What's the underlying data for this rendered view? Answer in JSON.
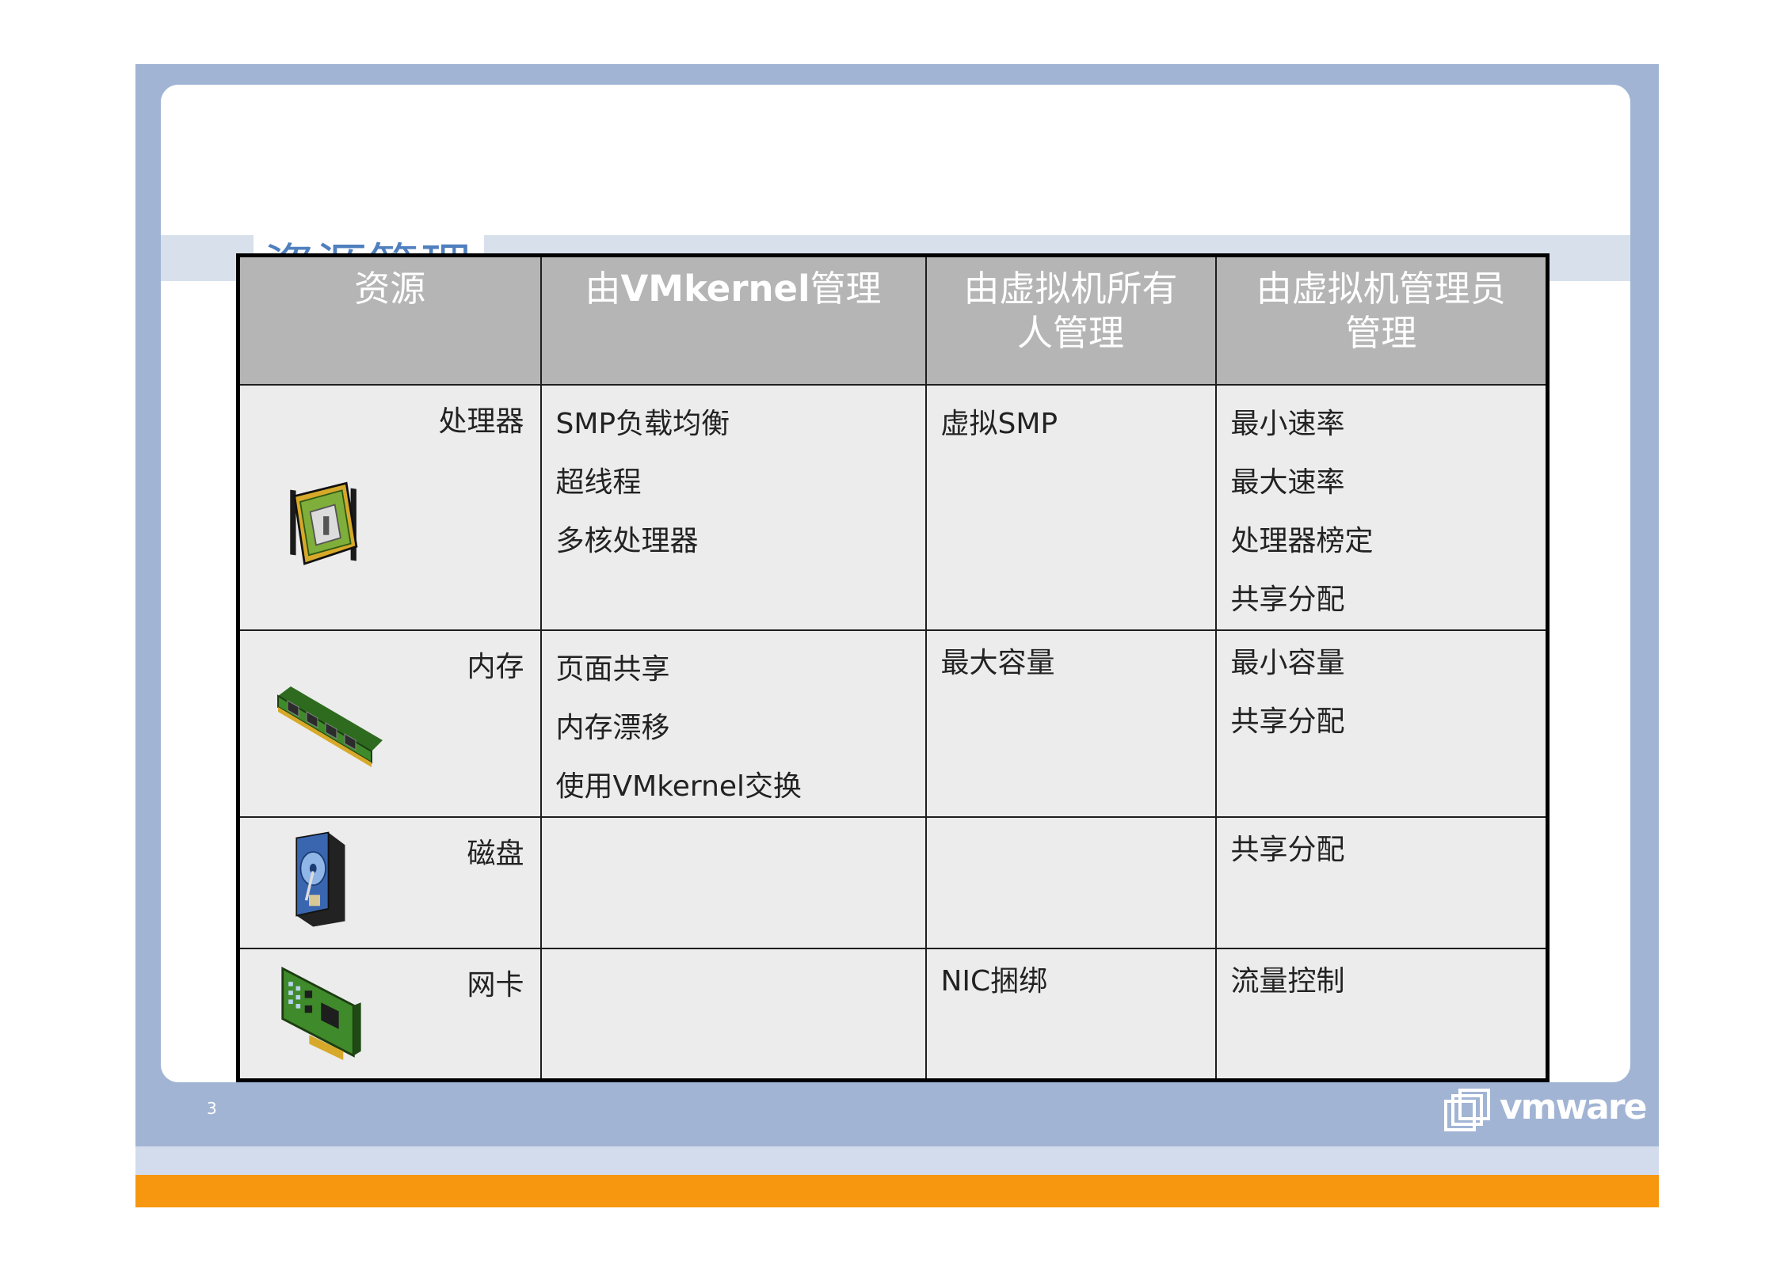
{
  "slide": {
    "title": "资源管理",
    "page_number": "3",
    "logo_text": "vmware",
    "colors": {
      "frame": "#a1b4d4",
      "accent": "#f7970f",
      "title": "#4f7fbe",
      "header": "#b5b5b5"
    }
  },
  "table": {
    "headers": {
      "resource": "资源",
      "vmkernel_prefix": "由",
      "vmkernel_bold": "VMkernel",
      "vmkernel_suffix": "管理",
      "owner_line1": "由虚拟机所有",
      "owner_line2": "人管理",
      "admin_line1": "由虚拟机管理员",
      "admin_line2": "管理"
    },
    "rows": [
      {
        "resource": "处理器",
        "icon": "cpu-icon",
        "vmkernel": [
          "SMP负载均衡",
          "超线程",
          "多核处理器"
        ],
        "owner": [
          "虚拟SMP"
        ],
        "admin": [
          "最小速率",
          "最大速率",
          "处理器榜定",
          "共享分配"
        ]
      },
      {
        "resource": "内存",
        "icon": "memory-icon",
        "vmkernel": [
          "页面共享",
          "内存漂移",
          "使用VMkernel交换"
        ],
        "owner": [
          "最大容量"
        ],
        "admin": [
          "最小容量",
          "共享分配"
        ]
      },
      {
        "resource": "磁盘",
        "icon": "disk-icon",
        "vmkernel": [],
        "owner": [],
        "admin": [
          "共享分配"
        ]
      },
      {
        "resource": "网卡",
        "icon": "nic-icon",
        "vmkernel": [],
        "owner": [
          "NIC捆绑"
        ],
        "admin": [
          "流量控制"
        ]
      }
    ]
  }
}
